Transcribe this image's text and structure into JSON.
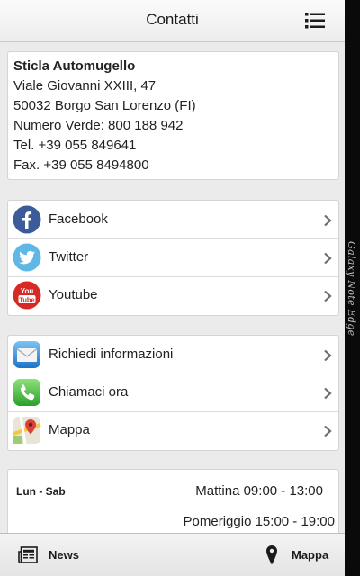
{
  "header": {
    "title": "Contatti"
  },
  "address": {
    "name": "Sticla Automugello",
    "street": "Viale Giovanni XXIII, 47",
    "city": "50032 Borgo San Lorenzo (FI)",
    "green_number": "Numero Verde: 800 188 942",
    "tel": "Tel. +39 055 849641",
    "fax": "Fax. +39 055 8494800"
  },
  "social": [
    {
      "label": "Facebook",
      "icon": "facebook-icon"
    },
    {
      "label": "Twitter",
      "icon": "twitter-icon"
    },
    {
      "label": "Youtube",
      "icon": "youtube-icon"
    }
  ],
  "youtube_logo": {
    "top": "You",
    "bottom": "Tube"
  },
  "actions": [
    {
      "label": "Richiedi informazioni",
      "icon": "mail-icon"
    },
    {
      "label": "Chiamaci ora",
      "icon": "phone-icon"
    },
    {
      "label": "Mappa",
      "icon": "maps-icon"
    }
  ],
  "hours": {
    "days": "Lun - Sab",
    "morning": "Mattina 09:00 - 13:00",
    "afternoon": "Pomeriggio 15:00 - 19:00"
  },
  "tabbar": {
    "news": "News",
    "map": "Mappa"
  },
  "device": {
    "edge_label": "Galaxy Note Edge"
  }
}
